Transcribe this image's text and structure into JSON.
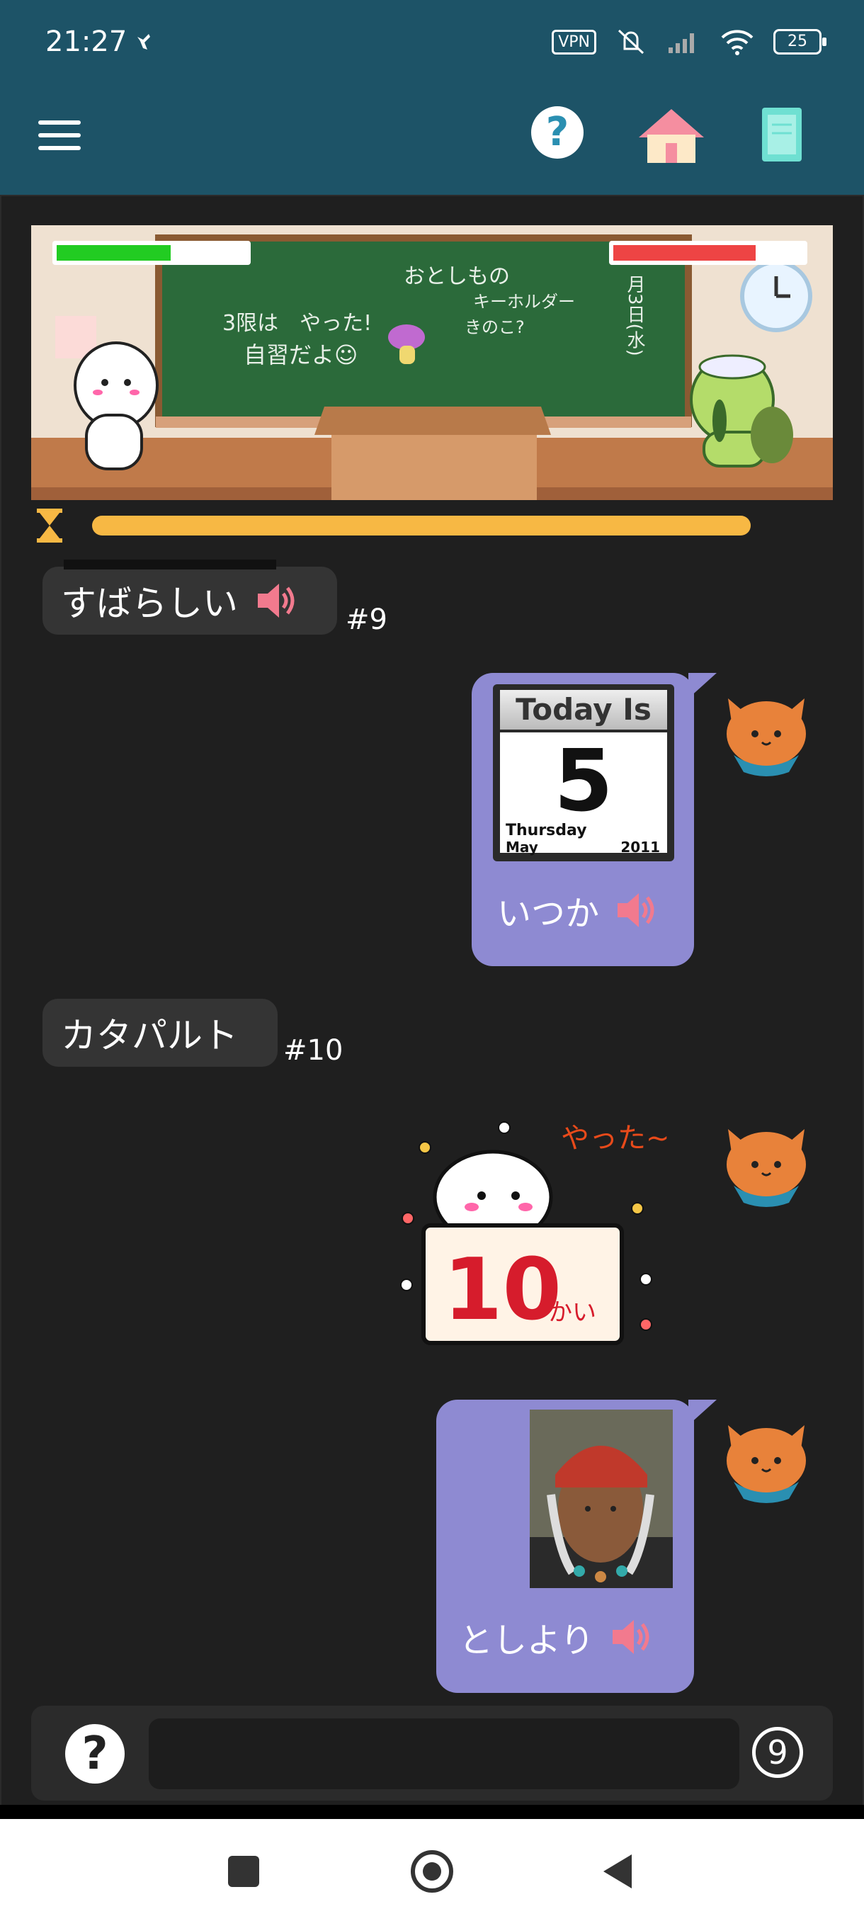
{
  "status": {
    "time": "21:27",
    "vpn": "VPN",
    "battery": "25"
  },
  "game": {
    "chalk_line1": "3限は　やった!",
    "chalk_line2": "自習だよ☺",
    "chalk_line3": "おとしもの",
    "chalk_line4": "キーホルダー",
    "chalk_line5": "きのこ?",
    "chalk_date": "月3日(水)",
    "player_hp": 0.6,
    "enemy_hp": 0.75,
    "timer": 1.0
  },
  "messages": {
    "m1": {
      "text": "すばらしい",
      "num": "#9"
    },
    "m2": {
      "calendar_title": "Today Is",
      "calendar_day": "5",
      "calendar_weekday": "Thursday",
      "calendar_month": "May",
      "calendar_year": "2011",
      "label": "いつか"
    },
    "m3": {
      "text": "カタパルト",
      "num": "#10"
    },
    "m4": {
      "sticker_text1": "やった~",
      "sticker_big": "10",
      "sticker_small": "かい"
    },
    "m5": {
      "label": "としより"
    }
  },
  "input": {
    "value": "",
    "count": "9"
  },
  "colors": {
    "appbar": "#1d5367",
    "bubble_user": "#8e8ad2",
    "bubble_other": "#343434",
    "timer": "#f7b844",
    "hp_player": "#22cc22",
    "hp_enemy": "#ee4444"
  },
  "icons": {
    "menu": "hamburger-icon",
    "help": "question-icon",
    "home": "house-icon",
    "book": "book-icon",
    "speaker": "speaker-icon",
    "avatar": "cat-icon"
  }
}
